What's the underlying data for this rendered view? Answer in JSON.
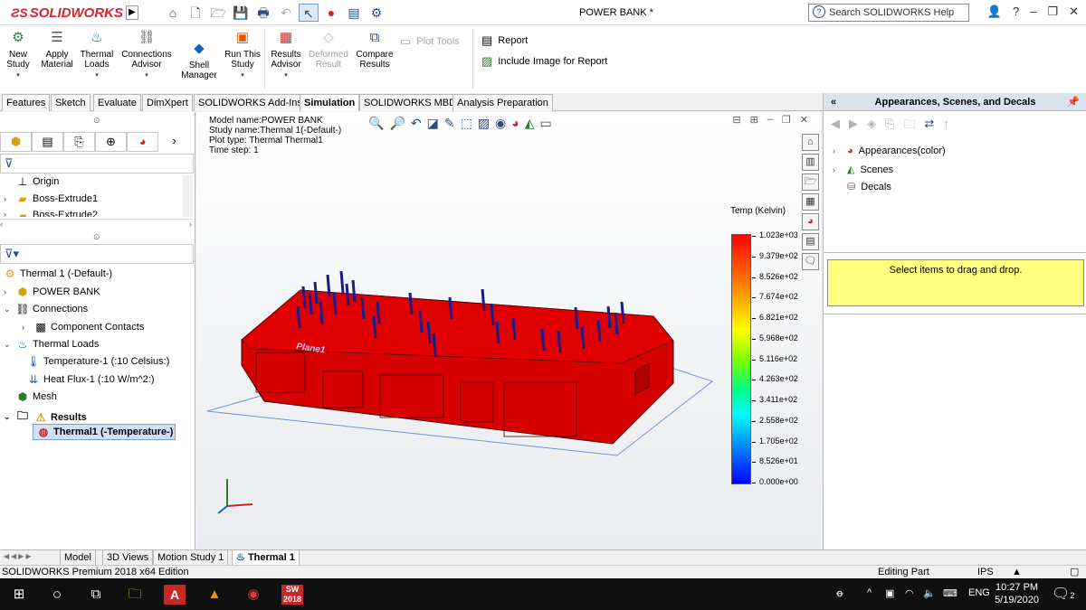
{
  "app": {
    "logo": "SOLIDWORKS",
    "document_title": "POWER BANK *",
    "search_placeholder": "Search SOLIDWORKS Help"
  },
  "toolbar": {
    "buttons": [
      {
        "label": "New\nStudy",
        "icon": "new-study-icon"
      },
      {
        "label": "Apply\nMaterial",
        "icon": "apply-material-icon"
      },
      {
        "label": "Thermal\nLoads",
        "icon": "thermal-loads-icon"
      },
      {
        "label": "Connections\nAdvisor",
        "icon": "connections-icon"
      },
      {
        "label": "Shell\nManager",
        "icon": "shell-manager-icon"
      },
      {
        "label": "Run This\nStudy",
        "icon": "run-study-icon"
      },
      {
        "label": "Results\nAdvisor",
        "icon": "results-advisor-icon"
      },
      {
        "label": "Deformed\nResult",
        "icon": "deformed-result-icon",
        "disabled": true
      },
      {
        "label": "Compare\nResults",
        "icon": "compare-results-icon"
      }
    ],
    "plot_tools": "Plot Tools",
    "report": "Report",
    "include_image": "Include Image for Report"
  },
  "tabs": [
    "Features",
    "Sketch",
    "Evaluate",
    "DimXpert",
    "SOLIDWORKS Add-Ins",
    "Simulation",
    "SOLIDWORKS MBD",
    "Analysis Preparation"
  ],
  "active_tab": "Simulation",
  "feature_tree": {
    "items": [
      "Origin",
      "Boss-Extrude1",
      "Boss-Extrude2"
    ]
  },
  "sim_tree": {
    "study": "Thermal 1 (-Default-)",
    "part": "POWER BANK",
    "connections": "Connections",
    "component_contacts": "Component Contacts",
    "thermal_loads": "Thermal Loads",
    "temperature": "Temperature-1 (:10 Celsius:)",
    "heat_flux": "Heat Flux-1 (:10 W/m^2:)",
    "mesh": "Mesh",
    "results": "Results",
    "result_item": "Thermal1 (-Temperature-)"
  },
  "model_info": {
    "model_name": "Model name:POWER BANK",
    "study_name": "Study name:Thermal 1(-Default-)",
    "plot_type": "Plot type: Thermal Thermal1",
    "time_step": "Time step: 1"
  },
  "plane_label": "Plane1",
  "legend": {
    "title": "Temp (Kelvin)",
    "labels": [
      "1.023e+03",
      "9.379e+02",
      "8.526e+02",
      "7.674e+02",
      "6.821e+02",
      "5.968e+02",
      "5.116e+02",
      "4.263e+02",
      "3.411e+02",
      "2.558e+02",
      "1.705e+02",
      "8.526e+01",
      "0.000e+00"
    ]
  },
  "right_pane": {
    "title": "Appearances, Scenes, and Decals",
    "items": [
      "Appearances(color)",
      "Scenes",
      "Decals"
    ],
    "drop_text": "Select items to drag and drop."
  },
  "bottom_tabs": [
    "Model",
    "3D Views",
    "Motion Study 1",
    "Thermal 1"
  ],
  "active_bottom_tab": "Thermal 1",
  "status": {
    "edition": "SOLIDWORKS Premium 2018 x64 Edition",
    "mode": "Editing Part",
    "units": "IPS"
  },
  "taskbar": {
    "language": "ENG",
    "time": "10:27 PM",
    "date": "5/19/2020",
    "notif_count": "2",
    "sw_label": "2018"
  }
}
